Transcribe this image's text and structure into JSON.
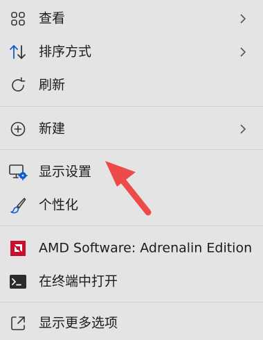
{
  "menu": {
    "items": [
      {
        "label": "查看",
        "icon": "grid-icon",
        "has_submenu": true
      },
      {
        "label": "排序方式",
        "icon": "sort-icon",
        "has_submenu": true
      },
      {
        "label": "刷新",
        "icon": "refresh-icon",
        "has_submenu": false
      },
      {
        "label": "新建",
        "icon": "plus-circle-icon",
        "has_submenu": true
      },
      {
        "label": "显示设置",
        "icon": "display-settings-icon",
        "has_submenu": false
      },
      {
        "label": "个性化",
        "icon": "brush-icon",
        "has_submenu": false
      },
      {
        "label": "AMD Software: Adrenalin Edition",
        "icon": "amd-logo-icon",
        "has_submenu": false
      },
      {
        "label": "在终端中打开",
        "icon": "terminal-icon",
        "has_submenu": false
      },
      {
        "label": "显示更多选项",
        "icon": "more-options-icon",
        "has_submenu": false
      }
    ]
  },
  "colors": {
    "menu_bg": "#e4e4e4",
    "text": "#1b1b1b",
    "accent_blue": "#0a5ccf",
    "amd_red": "#c8102e",
    "arrow_red": "#ee4a4a"
  }
}
